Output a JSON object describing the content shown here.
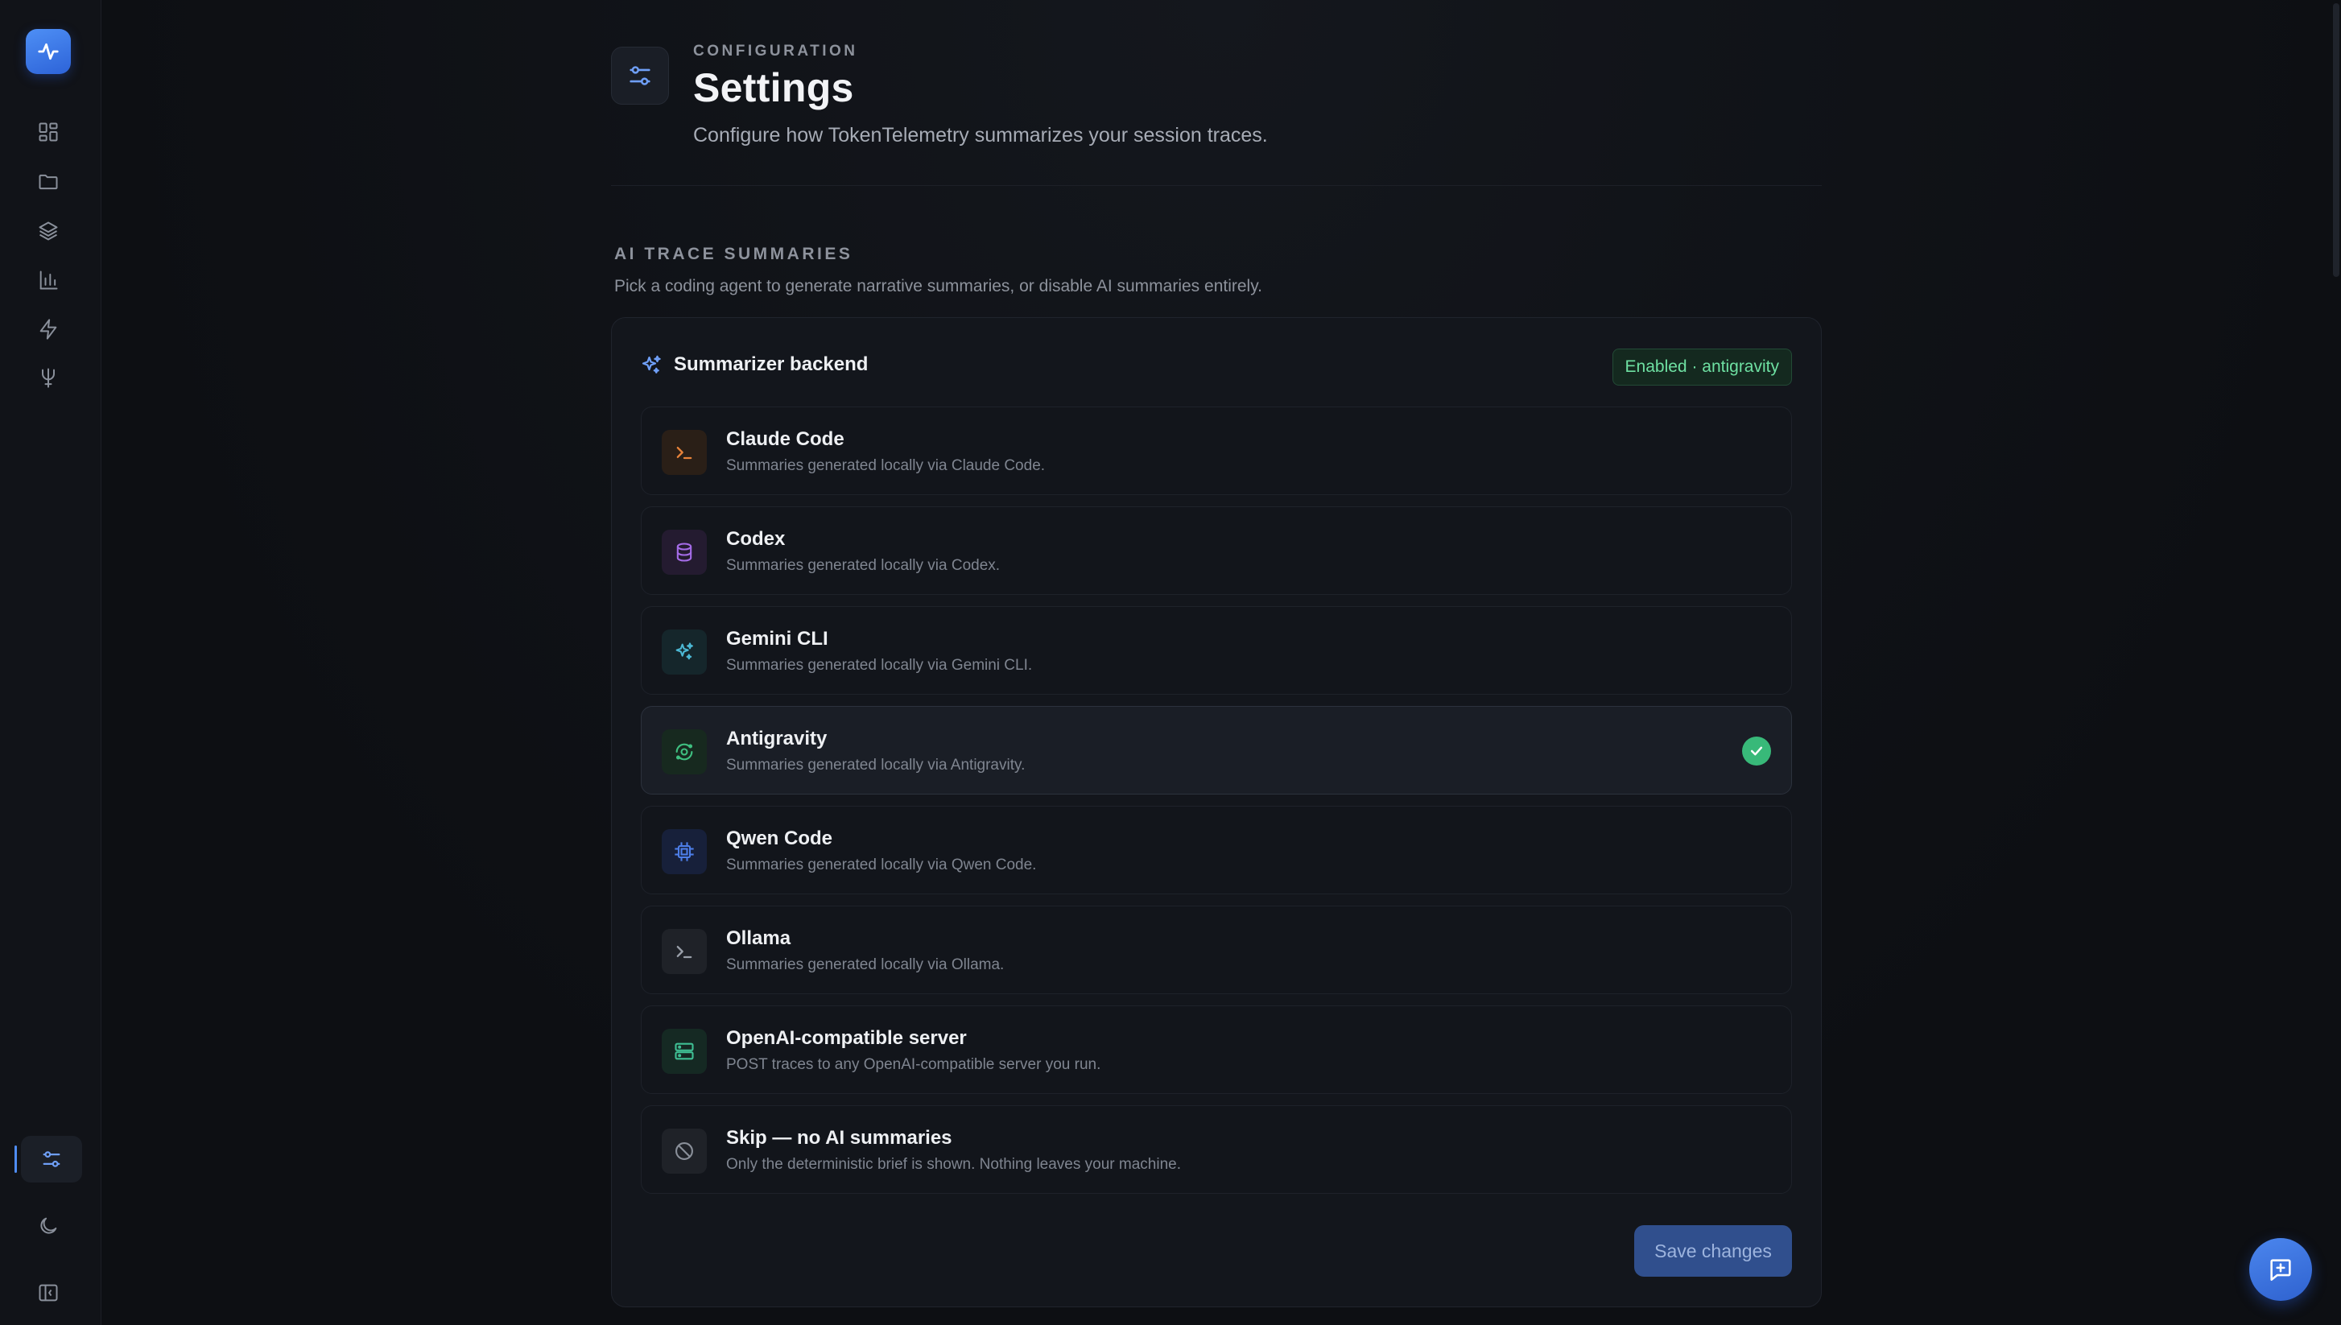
{
  "sidebar": {
    "nav": [
      {
        "name": "dashboard",
        "icon": "dashboard-icon"
      },
      {
        "name": "folder",
        "icon": "folder-icon"
      },
      {
        "name": "layers",
        "icon": "layers-icon"
      },
      {
        "name": "analytics",
        "icon": "bar-chart-icon"
      },
      {
        "name": "activity",
        "icon": "lightning-icon"
      },
      {
        "name": "trident",
        "icon": "trident-icon"
      }
    ],
    "bottom": [
      {
        "name": "settings",
        "icon": "sliders-icon",
        "active": true
      },
      {
        "name": "theme",
        "icon": "moon-icon"
      },
      {
        "name": "collapse",
        "icon": "sidebar-collapse-icon"
      }
    ]
  },
  "header": {
    "eyebrow": "CONFIGURATION",
    "title": "Settings",
    "subtitle": "Configure how TokenTelemetry summarizes your session traces."
  },
  "section": {
    "label": "AI TRACE SUMMARIES",
    "description": "Pick a coding agent to generate narrative summaries, or disable AI summaries entirely."
  },
  "card": {
    "title": "Summarizer backend",
    "badge": "Enabled · antigravity",
    "options": [
      {
        "title": "Claude Code",
        "desc": "Summaries generated locally via Claude Code.",
        "icon": "terminal-icon",
        "color": "#e8833a",
        "bg": "#2a1f17",
        "selected": false
      },
      {
        "title": "Codex",
        "desc": "Summaries generated locally via Codex.",
        "icon": "database-icon",
        "color": "#a56ce8",
        "bg": "#241b30",
        "selected": false
      },
      {
        "title": "Gemini CLI",
        "desc": "Summaries generated locally via Gemini CLI.",
        "icon": "sparkles-icon",
        "color": "#4cb8d4",
        "bg": "#15262b",
        "selected": false
      },
      {
        "title": "Antigravity",
        "desc": "Summaries generated locally via Antigravity.",
        "icon": "orbit-icon",
        "color": "#3fbf80",
        "bg": "#17291f",
        "selected": true
      },
      {
        "title": "Qwen Code",
        "desc": "Summaries generated locally via Qwen Code.",
        "icon": "cpu-icon",
        "color": "#4d7ee8",
        "bg": "#17203a",
        "selected": false
      },
      {
        "title": "Ollama",
        "desc": "Summaries generated locally via Ollama.",
        "icon": "terminal-icon",
        "color": "#9aa0aa",
        "bg": "#1f2228",
        "selected": false
      },
      {
        "title": "OpenAI-compatible server",
        "desc": "POST traces to any OpenAI-compatible server you run.",
        "icon": "server-icon",
        "color": "#3fbf94",
        "bg": "#152923",
        "selected": false
      },
      {
        "title": "Skip — no AI summaries",
        "desc": "Only the deterministic brief is shown. Nothing leaves your machine.",
        "icon": "ban-icon",
        "color": "#8a909a",
        "bg": "#1f2228",
        "selected": false
      }
    ],
    "save_label": "Save changes"
  },
  "colors": {
    "accent": "#4f8df5",
    "success": "#38b979",
    "background": "#0d0f13"
  }
}
